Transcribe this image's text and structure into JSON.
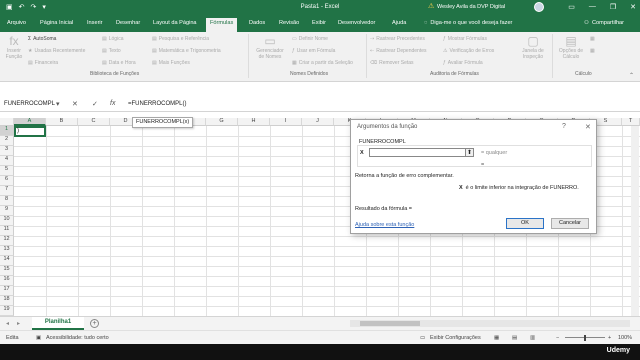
{
  "titlebar": {
    "save_icon": "save-icon",
    "undo_icon": "undo-icon",
    "redo_icon": "redo-icon",
    "customize_icon": "customize-qat-icon",
    "title": "Pasta1  -  Excel",
    "user": "Wesley Avila da DVP Digital",
    "minimize": "—",
    "restore": "❐",
    "close": "✕",
    "ribbon_display": "▭"
  },
  "tabs": {
    "arquivo": "Arquivo",
    "pagina_inicial": "Página Inicial",
    "inserir": "Inserir",
    "desenhar": "Desenhar",
    "layout": "Layout da Página",
    "formulas": "Fórmulas",
    "dados": "Dados",
    "revisao": "Revisão",
    "exibir": "Exibir",
    "desenvolvedor": "Desenvolvedor",
    "ajuda": "Ajuda",
    "tell_me": "Diga-me o que você deseja fazer",
    "share": "Compartilhar"
  },
  "ribbon": {
    "inserir_funcao": "Inserir\nFunção",
    "autosoma": "AutoSoma",
    "usadas_recentemente": "Usadas Recentemente",
    "financeira": "Financeira",
    "logica": "Lógica",
    "texto": "Texto",
    "data_hora": "Data e Hora",
    "pesquisa_referencia": "Pesquisa e Referência",
    "matematica": "Matemática e Trigonometria",
    "mais_funcoes": "Mais Funções",
    "group_biblioteca": "Biblioteca de Funções",
    "gerenciador_nomes": "Gerenciador\nde Nomes",
    "definir_nome": "Definir Nome",
    "usar_formula": "Usar em Fórmula",
    "criar_selecao": "Criar a partir da Seleção",
    "group_nomes": "Nomes Definidos",
    "rastrear_precedentes": "Rastrear Precedentes",
    "rastrear_dependentes": "Rastrear Dependentes",
    "remover_setas": "Remover Setas",
    "mostrar_formulas": "Mostrar Fórmulas",
    "verificacao_erros": "Verificação de Erros",
    "avaliar_formula": "Avaliar Fórmula",
    "janela_inspecao": "Janela de\nInspeção",
    "group_auditoria": "Auditoria de Fórmulas",
    "opcoes_calculo": "Opções de\nCálculo",
    "group_calculo": "Cálculo"
  },
  "formula_bar": {
    "name_box": "FUNERROCOMPL",
    "cancel": "✕",
    "enter": "✓",
    "fx": "fx",
    "formula": "=FUNERROCOMPL()"
  },
  "grid": {
    "columns": [
      "A",
      "B",
      "C",
      "D",
      "E",
      "F",
      "G",
      "H",
      "I",
      "J",
      "K",
      "L",
      "M",
      "N",
      "O",
      "P",
      "Q",
      "R",
      "S",
      "T"
    ],
    "rows": [
      "1",
      "2",
      "3",
      "4",
      "5",
      "6",
      "7",
      "8",
      "9",
      "10",
      "11",
      "12",
      "13",
      "14",
      "15",
      "16",
      "17",
      "18",
      "19"
    ],
    "active_cell_text": ")",
    "tooltip": "FUNERROCOMPL(x)"
  },
  "dialog": {
    "title": "Argumentos da função",
    "help_icon": "?",
    "close_icon": "✕",
    "function_name": "FUNERROCOMPL",
    "arg_label": "X",
    "arg_value": "",
    "arg_result": "=  qualquer",
    "result_eq": "=",
    "description": "Retorna a função de erro complementar.",
    "arg_desc_label": "X",
    "arg_desc": "é o limite inferior na integração de FUNERRO.",
    "formula_result": "Resultado da fórmula =",
    "help_link": "Ajuda sobre esta função",
    "ok": "OK",
    "cancel": "Cancelar"
  },
  "sheets": {
    "tab": "Planilha1",
    "add": "+"
  },
  "status": {
    "mode": "Edita",
    "accessibility": "Acessibilidade: tudo certo",
    "display_settings": "Exibir Configurações",
    "zoom_minus": "−",
    "zoom_plus": "+",
    "zoom": "100%"
  },
  "bottom": {
    "brand": "Udemy"
  },
  "colors": {
    "accent": "#217346",
    "link": "#2e62b5"
  }
}
